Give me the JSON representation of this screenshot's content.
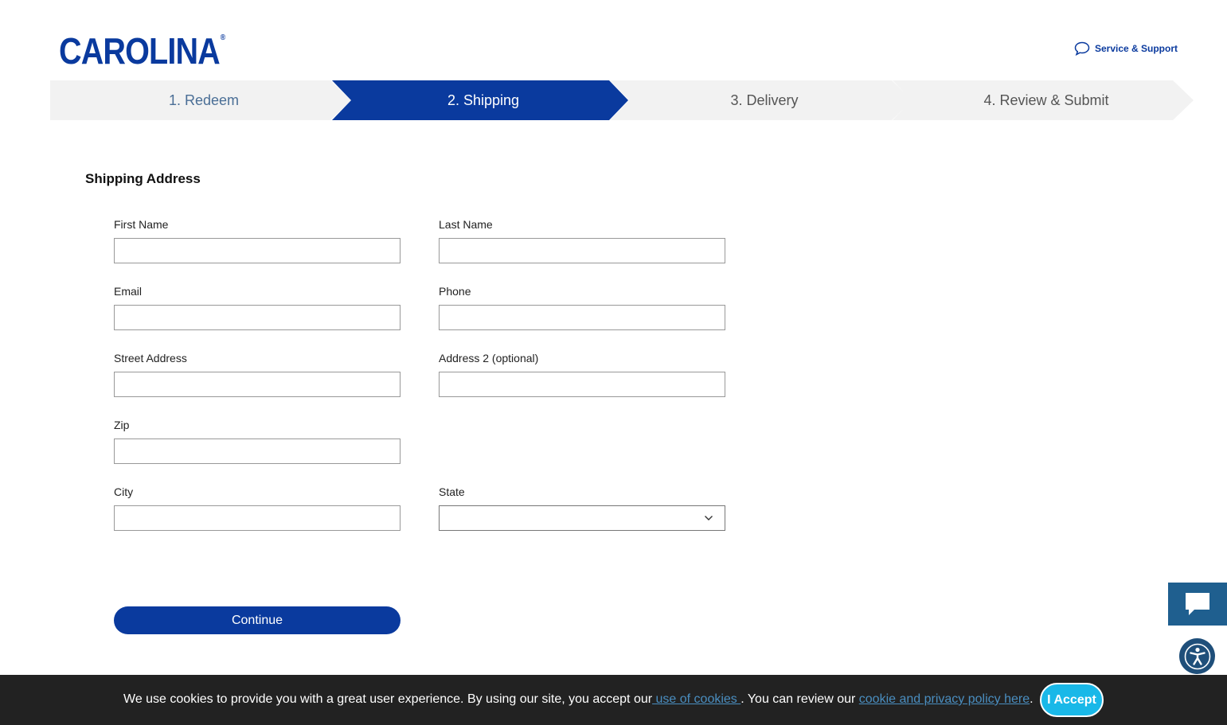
{
  "header": {
    "logo_text": "CAROLINA",
    "logo_reg": "®",
    "support_label": "Service & Support"
  },
  "stepper": {
    "steps": [
      {
        "label": "1. Redeem",
        "state": "completed"
      },
      {
        "label": "2. Shipping",
        "state": "active"
      },
      {
        "label": "3. Delivery",
        "state": "upcoming"
      },
      {
        "label": "4. Review & Submit",
        "state": "upcoming"
      }
    ]
  },
  "form": {
    "title": "Shipping Address",
    "first_name": {
      "label": "First Name",
      "value": ""
    },
    "last_name": {
      "label": "Last Name",
      "value": ""
    },
    "email": {
      "label": "Email",
      "value": ""
    },
    "phone": {
      "label": "Phone",
      "value": ""
    },
    "street": {
      "label": "Street Address",
      "value": ""
    },
    "address2": {
      "label": "Address 2 (optional)",
      "value": ""
    },
    "zip": {
      "label": "Zip",
      "value": ""
    },
    "city": {
      "label": "City",
      "value": ""
    },
    "state": {
      "label": "State",
      "value": ""
    },
    "continue_label": "Continue"
  },
  "cookie": {
    "text_1": "We use cookies to provide you with a great user experience. By using our site, you accept our",
    "link_1": " use of cookies ",
    "text_2": ". You can review our ",
    "link_2": "cookie and privacy policy here",
    "text_3": ".",
    "accept_label": "I Accept"
  },
  "colors": {
    "brand_blue": "#0a3a9e",
    "step_inactive": "#f2f2f2",
    "cookie_bg": "#222222",
    "accept_button": "#19b8e8",
    "chat_fab": "#1f5f8f"
  },
  "icons": {
    "support": "chat-bubble-icon",
    "state_select": "chevron-down-icon",
    "chat_fab": "chat-icon",
    "a11y_fab": "accessibility-icon"
  }
}
